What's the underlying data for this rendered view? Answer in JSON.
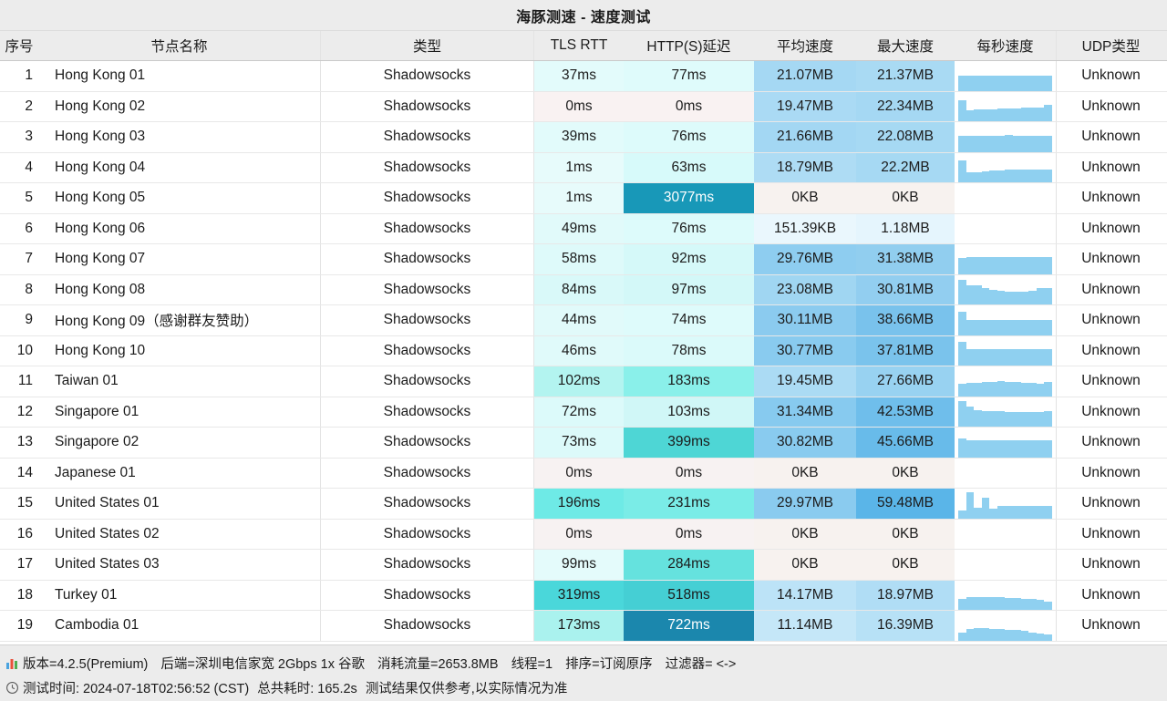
{
  "window": {
    "title": "海豚测速 - 速度测试"
  },
  "table": {
    "columns": [
      {
        "key": "index",
        "label": "序号"
      },
      {
        "key": "name",
        "label": "节点名称"
      },
      {
        "key": "type",
        "label": "类型"
      },
      {
        "key": "tls_rtt",
        "label": "TLS RTT"
      },
      {
        "key": "http_latency",
        "label": "HTTP(S)延迟"
      },
      {
        "key": "avg_speed",
        "label": "平均速度"
      },
      {
        "key": "max_speed",
        "label": "最大速度"
      },
      {
        "key": "per_second",
        "label": "每秒速度"
      },
      {
        "key": "udp_type",
        "label": "UDP类型"
      }
    ],
    "rows": [
      {
        "index": "1",
        "name": "Hong Kong 01",
        "type": "Shadowsocks",
        "tls_rtt": "37ms",
        "http_latency": "77ms",
        "avg_speed": "21.07MB",
        "max_speed": "21.37MB",
        "udp_type": "Unknown",
        "tls_bg": "#e3fbfb",
        "http_bg": "#dffbfb",
        "avg_bg": "#a5d8f3",
        "max_bg": "#a9daf3",
        "spark": [
          0.55,
          0.57,
          0.57,
          0.57,
          0.57,
          0.57,
          0.57,
          0.57,
          0.57,
          0.57,
          0.57,
          0.57
        ]
      },
      {
        "index": "2",
        "name": "Hong Kong 02",
        "type": "Shadowsocks",
        "tls_rtt": "0ms",
        "http_latency": "0ms",
        "avg_speed": "19.47MB",
        "max_speed": "22.34MB",
        "udp_type": "Unknown",
        "tls_bg": "#f9f2f2",
        "http_bg": "#f9f2f2",
        "avg_bg": "#aadaf4",
        "max_bg": "#a5d8f3",
        "spark": [
          0.78,
          0.42,
          0.43,
          0.45,
          0.45,
          0.46,
          0.47,
          0.48,
          0.5,
          0.5,
          0.52,
          0.6
        ]
      },
      {
        "index": "3",
        "name": "Hong Kong 03",
        "type": "Shadowsocks",
        "tls_rtt": "39ms",
        "http_latency": "76ms",
        "avg_speed": "21.66MB",
        "max_speed": "22.08MB",
        "udp_type": "Unknown",
        "tls_bg": "#e2fbfb",
        "http_bg": "#ddfbfb",
        "avg_bg": "#a3d7f3",
        "max_bg": "#a6d9f3",
        "spark": [
          0.58,
          0.58,
          0.58,
          0.58,
          0.58,
          0.6,
          0.63,
          0.6,
          0.6,
          0.6,
          0.6,
          0.6
        ]
      },
      {
        "index": "4",
        "name": "Hong Kong 04",
        "type": "Shadowsocks",
        "tls_rtt": "1ms",
        "http_latency": "63ms",
        "avg_speed": "18.79MB",
        "max_speed": "22.2MB",
        "udp_type": "Unknown",
        "tls_bg": "#e7fbfb",
        "http_bg": "#d7fafa",
        "avg_bg": "#aedcf4",
        "max_bg": "#a6d9f3",
        "spark": [
          0.8,
          0.36,
          0.38,
          0.4,
          0.44,
          0.44,
          0.47,
          0.47,
          0.47,
          0.47,
          0.47,
          0.48
        ]
      },
      {
        "index": "5",
        "name": "Hong Kong 05",
        "type": "Shadowsocks",
        "tls_rtt": "1ms",
        "http_latency": "3077ms",
        "avg_speed": "0KB",
        "max_speed": "0KB",
        "udp_type": "Unknown",
        "tls_bg": "#e7fbfb",
        "http_bg": "#1898b8",
        "http_fg": "#ffffff",
        "avg_bg": "#f7f2ef",
        "max_bg": "#f7f2ef",
        "spark": []
      },
      {
        "index": "6",
        "name": "Hong Kong 06",
        "type": "Shadowsocks",
        "tls_rtt": "49ms",
        "http_latency": "76ms",
        "avg_speed": "151.39KB",
        "max_speed": "1.18MB",
        "udp_type": "Unknown",
        "tls_bg": "#e1fafa",
        "http_bg": "#ddfbfb",
        "avg_bg": "#eaf7fd",
        "max_bg": "#e5f5fd",
        "spark": []
      },
      {
        "index": "7",
        "name": "Hong Kong 07",
        "type": "Shadowsocks",
        "tls_rtt": "58ms",
        "http_latency": "92ms",
        "avg_speed": "29.76MB",
        "max_speed": "31.38MB",
        "udp_type": "Unknown",
        "tls_bg": "#defafa",
        "http_bg": "#d5f9f9",
        "avg_bg": "#8ecdf0",
        "max_bg": "#91ceef",
        "spark": [
          0.6,
          0.62,
          0.62,
          0.62,
          0.62,
          0.62,
          0.62,
          0.62,
          0.62,
          0.62,
          0.62,
          0.62
        ]
      },
      {
        "index": "8",
        "name": "Hong Kong 08",
        "type": "Shadowsocks",
        "tls_rtt": "84ms",
        "http_latency": "97ms",
        "avg_speed": "23.08MB",
        "max_speed": "30.81MB",
        "udp_type": "Unknown",
        "tls_bg": "#d9f9f9",
        "http_bg": "#d3f8f8",
        "avg_bg": "#a0d6f2",
        "max_bg": "#92cef0",
        "spark": [
          0.9,
          0.72,
          0.7,
          0.6,
          0.55,
          0.5,
          0.48,
          0.47,
          0.46,
          0.5,
          0.6,
          0.62
        ]
      },
      {
        "index": "9",
        "name": "Hong Kong 09（感谢群友赞助）",
        "type": "Shadowsocks",
        "tls_rtt": "44ms",
        "http_latency": "74ms",
        "avg_speed": "30.11MB",
        "max_speed": "38.66MB",
        "udp_type": "Unknown",
        "tls_bg": "#e1fafa",
        "http_bg": "#defbfb",
        "avg_bg": "#8bcbef",
        "max_bg": "#79c2ec",
        "spark": [
          0.85,
          0.55,
          0.55,
          0.55,
          0.55,
          0.55,
          0.55,
          0.55,
          0.55,
          0.55,
          0.55,
          0.55
        ]
      },
      {
        "index": "10",
        "name": "Hong Kong 10",
        "type": "Shadowsocks",
        "tls_rtt": "46ms",
        "http_latency": "78ms",
        "avg_speed": "30.77MB",
        "max_speed": "37.81MB",
        "udp_type": "Unknown",
        "tls_bg": "#e0fafa",
        "http_bg": "#dbfafa",
        "avg_bg": "#89cbef",
        "max_bg": "#7ac3ec",
        "spark": [
          0.88,
          0.62,
          0.62,
          0.62,
          0.62,
          0.62,
          0.62,
          0.62,
          0.62,
          0.62,
          0.62,
          0.62
        ]
      },
      {
        "index": "11",
        "name": "Taiwan 01",
        "type": "Shadowsocks",
        "tls_rtt": "102ms",
        "http_latency": "183ms",
        "avg_speed": "19.45MB",
        "max_speed": "27.66MB",
        "udp_type": "Unknown",
        "tls_bg": "#b3f4f0",
        "http_bg": "#8af0ea",
        "avg_bg": "#abdbf4",
        "max_bg": "#98d2f1",
        "spark": [
          0.45,
          0.48,
          0.5,
          0.52,
          0.52,
          0.55,
          0.53,
          0.52,
          0.5,
          0.48,
          0.47,
          0.52
        ]
      },
      {
        "index": "12",
        "name": "Singapore 01",
        "type": "Shadowsocks",
        "tls_rtt": "72ms",
        "http_latency": "103ms",
        "avg_speed": "31.34MB",
        "max_speed": "42.53MB",
        "udp_type": "Unknown",
        "tls_bg": "#dcfafa",
        "http_bg": "#d0f7f7",
        "avg_bg": "#87caef",
        "max_bg": "#6fbeeb",
        "spark": [
          0.95,
          0.75,
          0.6,
          0.58,
          0.57,
          0.56,
          0.55,
          0.54,
          0.54,
          0.54,
          0.55,
          0.58
        ]
      },
      {
        "index": "13",
        "name": "Singapore 02",
        "type": "Shadowsocks",
        "tls_rtt": "73ms",
        "http_latency": "399ms",
        "avg_speed": "30.82MB",
        "max_speed": "45.66MB",
        "udp_type": "Unknown",
        "tls_bg": "#dcfafa",
        "http_bg": "#4ed6d5",
        "avg_bg": "#89cbef",
        "max_bg": "#68bbea",
        "spark": [
          0.7,
          0.62,
          0.62,
          0.62,
          0.62,
          0.62,
          0.62,
          0.62,
          0.62,
          0.62,
          0.62,
          0.62
        ]
      },
      {
        "index": "14",
        "name": "Japanese 01",
        "type": "Shadowsocks",
        "tls_rtt": "0ms",
        "http_latency": "0ms",
        "avg_speed": "0KB",
        "max_speed": "0KB",
        "udp_type": "Unknown",
        "tls_bg": "#f7f2f2",
        "http_bg": "#f7f2f2",
        "avg_bg": "#f7f2ef",
        "max_bg": "#f7f2ef",
        "spark": []
      },
      {
        "index": "15",
        "name": "United States 01",
        "type": "Shadowsocks",
        "tls_rtt": "196ms",
        "http_latency": "231ms",
        "avg_speed": "29.97MB",
        "max_speed": "59.48MB",
        "udp_type": "Unknown",
        "tls_bg": "#6eeae6",
        "http_bg": "#7aece7",
        "avg_bg": "#8acbef",
        "max_bg": "#5ab5e8",
        "spark": [
          0.28,
          0.95,
          0.4,
          0.78,
          0.35,
          0.45,
          0.45,
          0.45,
          0.45,
          0.45,
          0.45,
          0.45
        ]
      },
      {
        "index": "16",
        "name": "United States 02",
        "type": "Shadowsocks",
        "tls_rtt": "0ms",
        "http_latency": "0ms",
        "avg_speed": "0KB",
        "max_speed": "0KB",
        "udp_type": "Unknown",
        "tls_bg": "#f7f2f2",
        "http_bg": "#f7f2f2",
        "avg_bg": "#f7f2ef",
        "max_bg": "#f7f2ef",
        "spark": []
      },
      {
        "index": "17",
        "name": "United States 03",
        "type": "Shadowsocks",
        "tls_rtt": "99ms",
        "http_latency": "284ms",
        "avg_speed": "0KB",
        "max_speed": "0KB",
        "udp_type": "Unknown",
        "tls_bg": "#e4fbfb",
        "http_bg": "#65e2de",
        "avg_bg": "#f7f2ef",
        "max_bg": "#f7f2ef",
        "spark": []
      },
      {
        "index": "18",
        "name": "Turkey 01",
        "type": "Shadowsocks",
        "tls_rtt": "319ms",
        "http_latency": "518ms",
        "avg_speed": "14.17MB",
        "max_speed": "18.97MB",
        "udp_type": "Unknown",
        "tls_bg": "#4ad7da",
        "http_bg": "#45cfd4",
        "avg_bg": "#bce3f7",
        "max_bg": "#b0ddf5",
        "spark": [
          0.4,
          0.46,
          0.48,
          0.48,
          0.46,
          0.46,
          0.45,
          0.44,
          0.42,
          0.4,
          0.38,
          0.3
        ]
      },
      {
        "index": "19",
        "name": "Cambodia 01",
        "type": "Shadowsocks",
        "tls_rtt": "173ms",
        "http_latency": "722ms",
        "avg_speed": "11.14MB",
        "max_speed": "16.39MB",
        "udp_type": "Unknown",
        "tls_bg": "#aaf2ee",
        "http_bg": "#1b87ad",
        "http_fg": "#ffffff",
        "avg_bg": "#c5e7f8",
        "max_bg": "#b7e1f6",
        "spark": [
          0.3,
          0.42,
          0.46,
          0.46,
          0.44,
          0.42,
          0.4,
          0.38,
          0.34,
          0.3,
          0.26,
          0.22
        ]
      }
    ]
  },
  "footer": {
    "line1_icon": "bar-chart-icon",
    "line1": {
      "version": "版本=4.2.5(Premium)",
      "backend": "后端=深圳电信家宽 2Gbps 1x 谷歌",
      "traffic": "消耗流量=2653.8MB",
      "threads": "线程=1",
      "sort": "排序=订阅原序",
      "filter": "过滤器= <->"
    },
    "line2_icon": "clock-icon",
    "line2": {
      "test_time": "测试时间: 2024-07-18T02:56:52 (CST)",
      "duration": "总共耗时: 165.2s",
      "disclaimer": "测试结果仅供参考,以实际情况为准"
    }
  },
  "colors": {
    "spark_bar": "#8fd0f0",
    "header_bg": "#ececec",
    "footer_bg": "#ececec"
  }
}
